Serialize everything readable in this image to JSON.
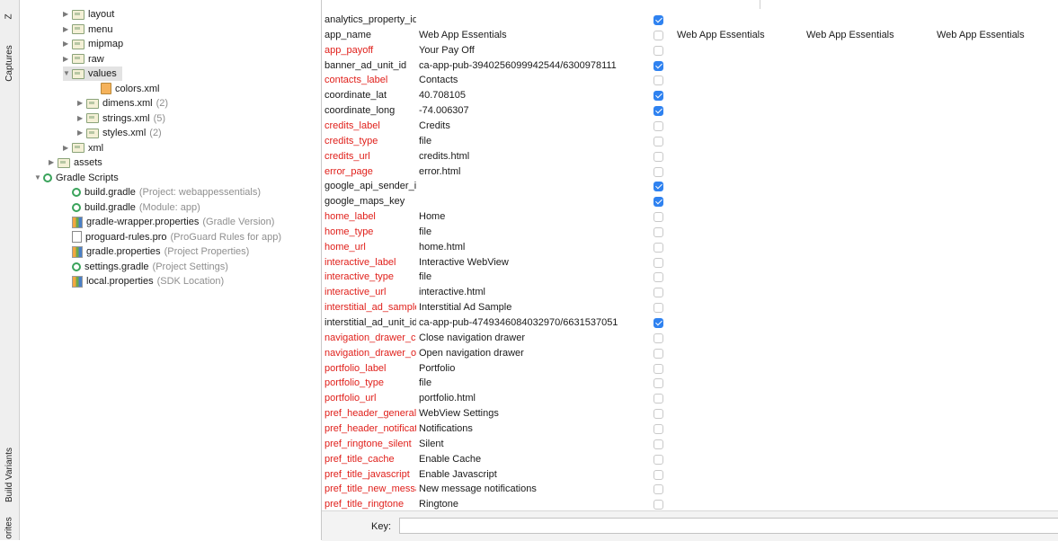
{
  "side_tabs": {
    "captures": "Captures",
    "build_variants": "Build Variants",
    "favorites": "orites",
    "top_label": "Z"
  },
  "tree": [
    {
      "indent": 48,
      "arrow": "▶",
      "icon": "folder",
      "label": "layout",
      "hint": ""
    },
    {
      "indent": 48,
      "arrow": "▶",
      "icon": "folder",
      "label": "menu",
      "hint": ""
    },
    {
      "indent": 48,
      "arrow": "▶",
      "icon": "folder",
      "label": "mipmap",
      "hint": ""
    },
    {
      "indent": 48,
      "arrow": "▶",
      "icon": "folder",
      "label": "raw",
      "hint": ""
    },
    {
      "indent": 48,
      "arrow": "▼",
      "icon": "folder",
      "label": "values",
      "hint": "",
      "selected": true
    },
    {
      "indent": 80,
      "arrow": "",
      "icon": "file",
      "label": "colors.xml",
      "hint": ""
    },
    {
      "indent": 64,
      "arrow": "▶",
      "icon": "folder",
      "label": "dimens.xml",
      "hint": "(2)"
    },
    {
      "indent": 64,
      "arrow": "▶",
      "icon": "folder",
      "label": "strings.xml",
      "hint": "(5)"
    },
    {
      "indent": 64,
      "arrow": "▶",
      "icon": "folder",
      "label": "styles.xml",
      "hint": "(2)"
    },
    {
      "indent": 48,
      "arrow": "▶",
      "icon": "folder",
      "label": "xml",
      "hint": ""
    },
    {
      "indent": 32,
      "arrow": "▶",
      "icon": "folder",
      "label": "assets",
      "hint": ""
    },
    {
      "indent": 16,
      "arrow": "▼",
      "icon": "gradle",
      "label": "Gradle Scripts",
      "hint": ""
    },
    {
      "indent": 48,
      "arrow": "",
      "icon": "gradle",
      "label": "build.gradle",
      "hint": "(Project: webappessentials)"
    },
    {
      "indent": 48,
      "arrow": "",
      "icon": "gradle",
      "label": "build.gradle",
      "hint": "(Module: app)"
    },
    {
      "indent": 48,
      "arrow": "",
      "icon": "prop",
      "label": "gradle-wrapper.properties",
      "hint": "(Gradle Version)"
    },
    {
      "indent": 48,
      "arrow": "",
      "icon": "txt",
      "label": "proguard-rules.pro",
      "hint": "(ProGuard Rules for app)"
    },
    {
      "indent": 48,
      "arrow": "",
      "icon": "prop",
      "label": "gradle.properties",
      "hint": "(Project Properties)"
    },
    {
      "indent": 48,
      "arrow": "",
      "icon": "gradle",
      "label": "settings.gradle",
      "hint": "(Project Settings)"
    },
    {
      "indent": 48,
      "arrow": "",
      "icon": "prop",
      "label": "local.properties",
      "hint": "(SDK Location)"
    }
  ],
  "rows": [
    {
      "key": "analytics_property_id",
      "red": false,
      "default": "",
      "untranslatable": true,
      "l1": "",
      "l2": "",
      "l3": ""
    },
    {
      "key": "app_name",
      "red": false,
      "default": "Web App Essentials",
      "untranslatable": false,
      "l1": "Web App Essentials",
      "l2": "Web App Essentials",
      "l3": "Web App Essentials"
    },
    {
      "key": "app_payoff",
      "red": true,
      "default": "Your Pay Off",
      "untranslatable": false,
      "l1": "",
      "l2": "",
      "l3": ""
    },
    {
      "key": "banner_ad_unit_id",
      "red": false,
      "default": "ca-app-pub-3940256099942544/6300978111",
      "untranslatable": true,
      "l1": "",
      "l2": "",
      "l3": ""
    },
    {
      "key": "contacts_label",
      "red": true,
      "default": "Contacts",
      "untranslatable": false,
      "l1": "",
      "l2": "",
      "l3": ""
    },
    {
      "key": "coordinate_lat",
      "red": false,
      "default": "40.708105",
      "untranslatable": true,
      "l1": "",
      "l2": "",
      "l3": ""
    },
    {
      "key": "coordinate_long",
      "red": false,
      "default": "-74.006307",
      "untranslatable": true,
      "l1": "",
      "l2": "",
      "l3": ""
    },
    {
      "key": "credits_label",
      "red": true,
      "default": "Credits",
      "untranslatable": false,
      "l1": "",
      "l2": "",
      "l3": ""
    },
    {
      "key": "credits_type",
      "red": true,
      "default": "file",
      "untranslatable": false,
      "l1": "",
      "l2": "",
      "l3": ""
    },
    {
      "key": "credits_url",
      "red": true,
      "default": "credits.html",
      "untranslatable": false,
      "l1": "",
      "l2": "",
      "l3": ""
    },
    {
      "key": "error_page",
      "red": true,
      "default": "error.html",
      "untranslatable": false,
      "l1": "",
      "l2": "",
      "l3": ""
    },
    {
      "key": "google_api_sender_id",
      "red": false,
      "default": "",
      "untranslatable": true,
      "l1": "",
      "l2": "",
      "l3": ""
    },
    {
      "key": "google_maps_key",
      "red": false,
      "default": "",
      "untranslatable": true,
      "l1": "",
      "l2": "",
      "l3": ""
    },
    {
      "key": "home_label",
      "red": true,
      "default": "Home",
      "untranslatable": false,
      "l1": "",
      "l2": "",
      "l3": ""
    },
    {
      "key": "home_type",
      "red": true,
      "default": "file",
      "untranslatable": false,
      "l1": "",
      "l2": "",
      "l3": ""
    },
    {
      "key": "home_url",
      "red": true,
      "default": "home.html",
      "untranslatable": false,
      "l1": "",
      "l2": "",
      "l3": ""
    },
    {
      "key": "interactive_label",
      "red": true,
      "default": "Interactive WebView",
      "untranslatable": false,
      "l1": "",
      "l2": "",
      "l3": ""
    },
    {
      "key": "interactive_type",
      "red": true,
      "default": "file",
      "untranslatable": false,
      "l1": "",
      "l2": "",
      "l3": ""
    },
    {
      "key": "interactive_url",
      "red": true,
      "default": "interactive.html",
      "untranslatable": false,
      "l1": "",
      "l2": "",
      "l3": ""
    },
    {
      "key": "interstitial_ad_sample",
      "red": true,
      "default": "Interstitial Ad Sample",
      "untranslatable": false,
      "l1": "",
      "l2": "",
      "l3": ""
    },
    {
      "key": "interstitial_ad_unit_id",
      "red": false,
      "default": "ca-app-pub-4749346084032970/6631537051",
      "untranslatable": true,
      "l1": "",
      "l2": "",
      "l3": ""
    },
    {
      "key": "navigation_drawer_close",
      "red": true,
      "default": "Close navigation drawer",
      "untranslatable": false,
      "l1": "",
      "l2": "",
      "l3": ""
    },
    {
      "key": "navigation_drawer_open",
      "red": true,
      "default": "Open navigation drawer",
      "untranslatable": false,
      "l1": "",
      "l2": "",
      "l3": ""
    },
    {
      "key": "portfolio_label",
      "red": true,
      "default": "Portfolio",
      "untranslatable": false,
      "l1": "",
      "l2": "",
      "l3": ""
    },
    {
      "key": "portfolio_type",
      "red": true,
      "default": "file",
      "untranslatable": false,
      "l1": "",
      "l2": "",
      "l3": ""
    },
    {
      "key": "portfolio_url",
      "red": true,
      "default": "portfolio.html",
      "untranslatable": false,
      "l1": "",
      "l2": "",
      "l3": ""
    },
    {
      "key": "pref_header_general",
      "red": true,
      "default": "WebView Settings",
      "untranslatable": false,
      "l1": "",
      "l2": "",
      "l3": ""
    },
    {
      "key": "pref_header_notifications",
      "red": true,
      "default": "Notifications",
      "untranslatable": false,
      "l1": "",
      "l2": "",
      "l3": ""
    },
    {
      "key": "pref_ringtone_silent",
      "red": true,
      "default": "Silent",
      "untranslatable": false,
      "l1": "",
      "l2": "",
      "l3": ""
    },
    {
      "key": "pref_title_cache",
      "red": true,
      "default": "Enable Cache",
      "untranslatable": false,
      "l1": "",
      "l2": "",
      "l3": ""
    },
    {
      "key": "pref_title_javascript",
      "red": true,
      "default": "Enable Javascript",
      "untranslatable": false,
      "l1": "",
      "l2": "",
      "l3": ""
    },
    {
      "key": "pref_title_new_message",
      "red": true,
      "default": "New message notifications",
      "untranslatable": false,
      "l1": "",
      "l2": "",
      "l3": ""
    },
    {
      "key": "pref_title_ringtone",
      "red": true,
      "default": "Ringtone",
      "untranslatable": false,
      "l1": "",
      "l2": "",
      "l3": ""
    }
  ],
  "footer": {
    "key_label": "Key:",
    "key_value": ""
  }
}
